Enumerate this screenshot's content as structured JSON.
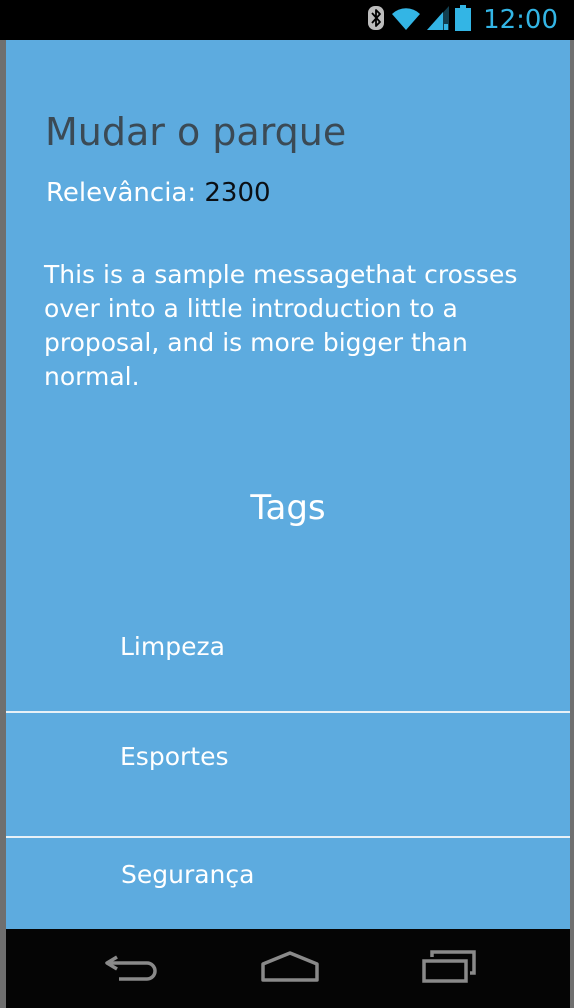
{
  "status_bar": {
    "time": "12:00",
    "icons": [
      "bluetooth-icon",
      "wifi-icon",
      "signal-icon",
      "battery-icon"
    ],
    "accent_color": "#33b5e5"
  },
  "proposal": {
    "title": "Mudar o parque",
    "relevance_label": "Relevância:",
    "relevance_value": "2300",
    "description": "This is a sample messagethat crosses over into a little introduction to a proposal, and is more bigger than normal."
  },
  "tags": {
    "heading": "Tags",
    "items": [
      {
        "label": "Limpeza"
      },
      {
        "label": "Esportes"
      },
      {
        "label": "Segurança"
      }
    ]
  },
  "nav_bar": {
    "buttons": [
      "back-icon",
      "home-icon",
      "recent-apps-icon"
    ]
  },
  "colors": {
    "background": "#5dabdf",
    "title": "#3b4a55",
    "text": "#ffffff"
  }
}
